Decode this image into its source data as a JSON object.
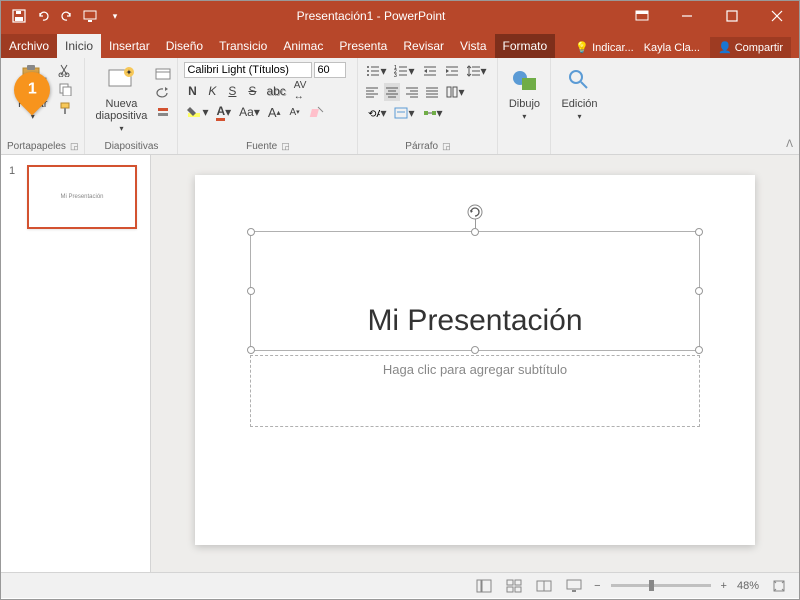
{
  "title": "Presentación1 - PowerPoint",
  "tabs": {
    "file": "Archivo",
    "home": "Inicio",
    "insert": "Insertar",
    "design": "Diseño",
    "transitions": "Transicio",
    "animations": "Animac",
    "slideshow": "Presenta",
    "review": "Revisar",
    "view": "Vista",
    "format": "Formato"
  },
  "tellme": "Indicar...",
  "user": "Kayla Cla...",
  "share": "Compartir",
  "groups": {
    "clipboard": {
      "paste": "Pegar",
      "label": "Portapapeles"
    },
    "slides": {
      "new": "Nueva\ndiapositiva",
      "label": "Diapositivas"
    },
    "font": {
      "name": "Calibri Light (Títulos)",
      "size": "60",
      "label": "Fuente"
    },
    "paragraph": {
      "label": "Párrafo"
    },
    "drawing": {
      "label": "Dibujo"
    },
    "editing": {
      "label": "Edición"
    }
  },
  "slide": {
    "number": "1",
    "title": "Mi Presentación",
    "subtitle_placeholder": "Haga clic para agregar subtítulo"
  },
  "status": {
    "zoom": "48%"
  },
  "callout_number": "1"
}
